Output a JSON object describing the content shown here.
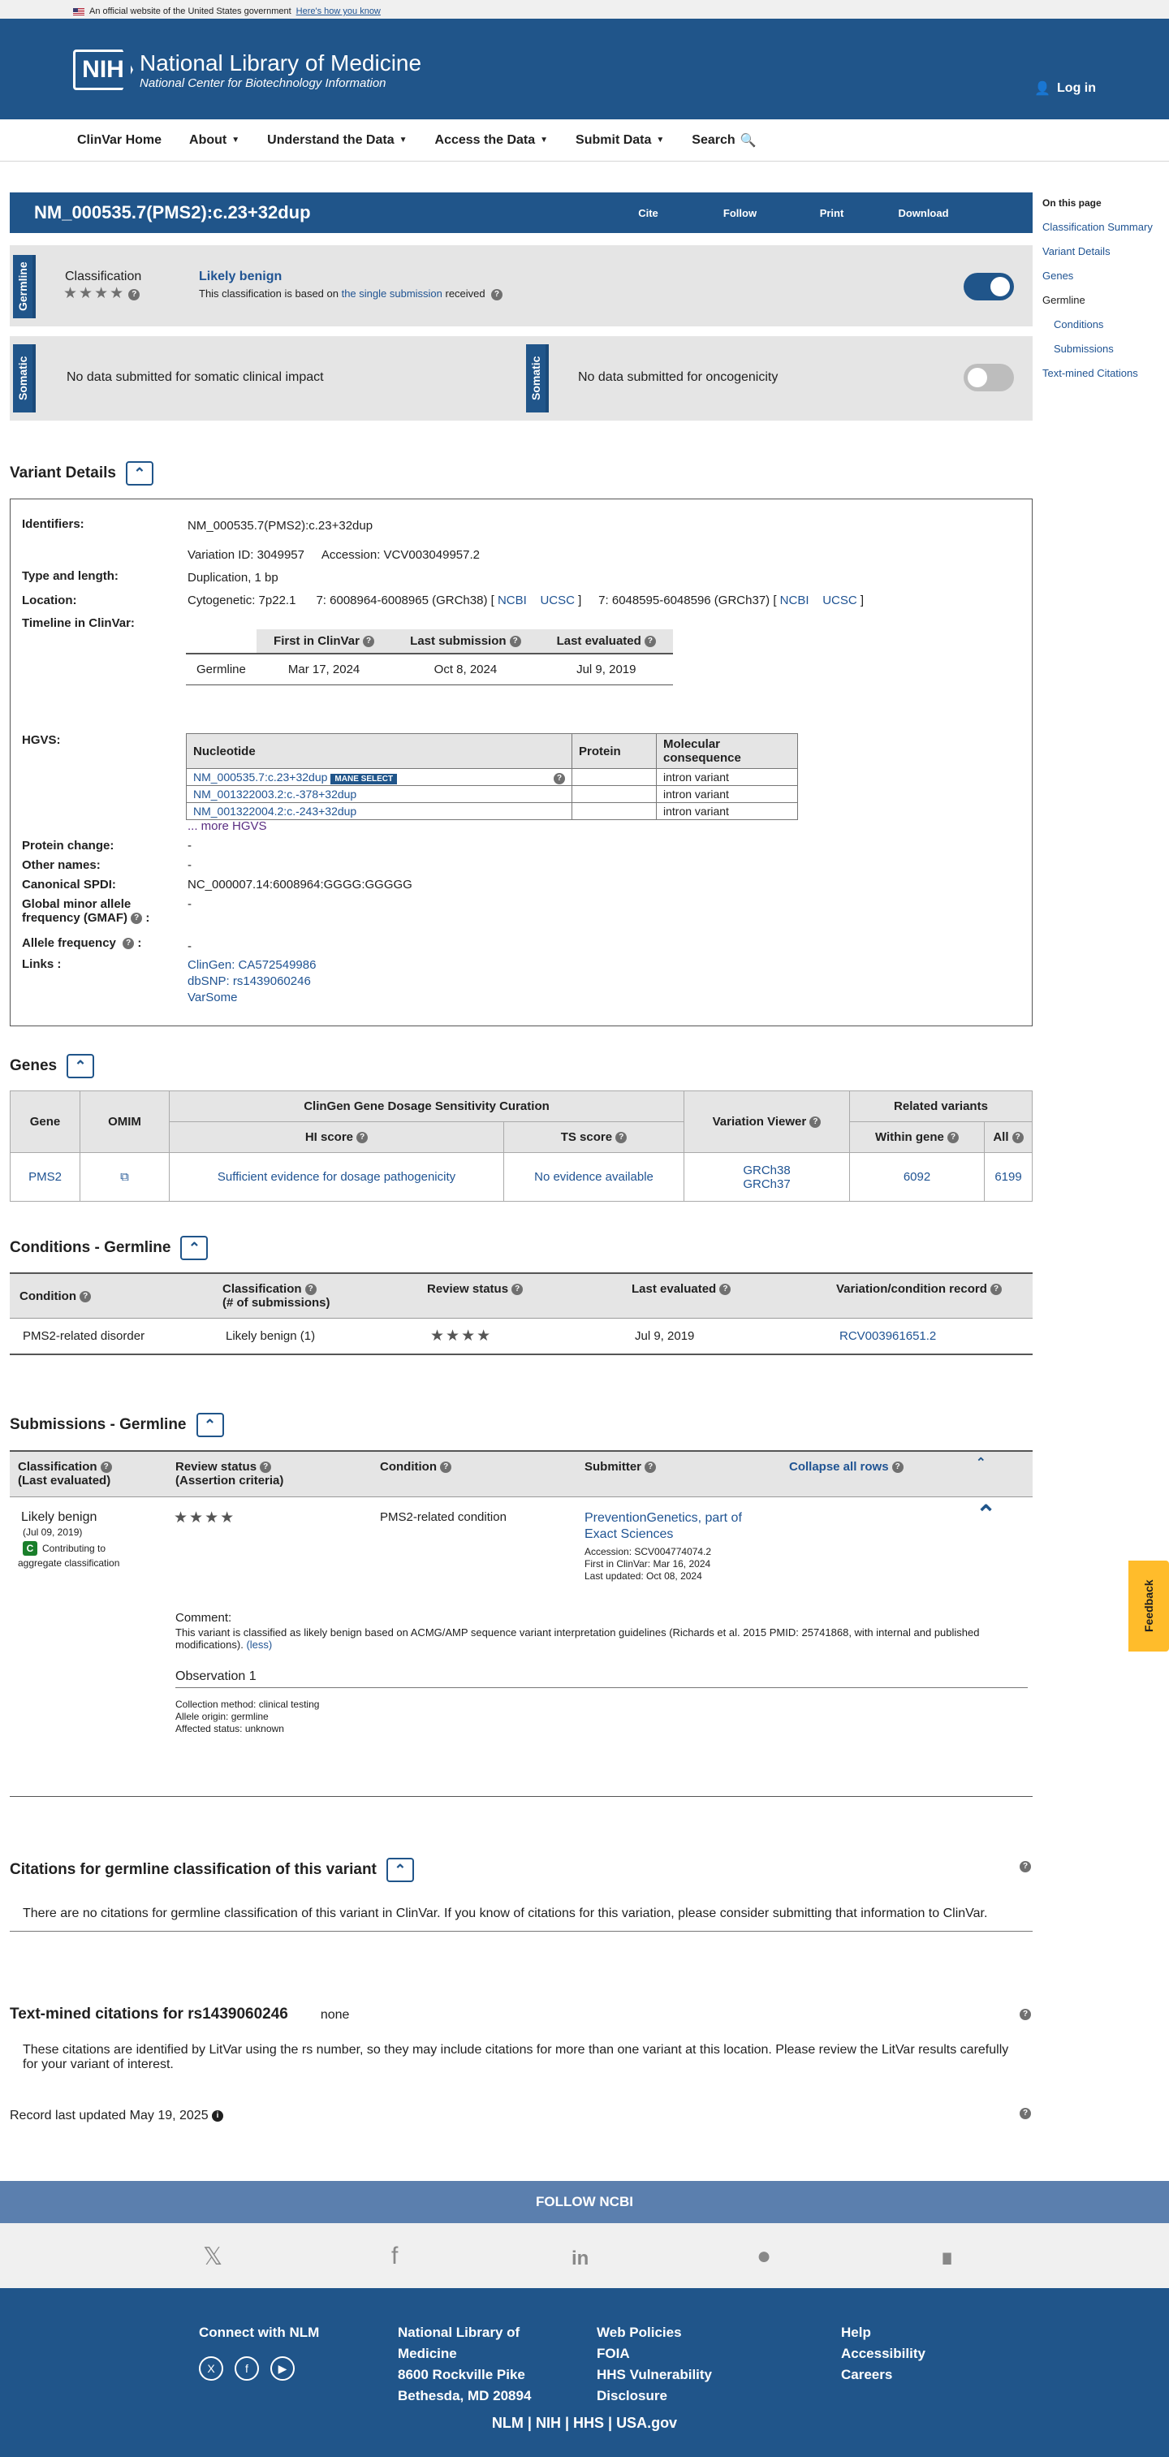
{
  "gov_banner": {
    "text": "An official website of the United States government",
    "link": "Here's how you know"
  },
  "header": {
    "logo": "NIH",
    "title": "National Library of Medicine",
    "subtitle": "National Center for Biotechnology Information",
    "login": "Log in"
  },
  "nav": [
    "ClinVar Home",
    "About",
    "Understand the Data",
    "Access the Data",
    "Submit Data",
    "Search"
  ],
  "title": {
    "name": "NM_000535.7(PMS2):c.23+32dup",
    "actions": [
      "Cite",
      "Follow",
      "Print",
      "Download"
    ]
  },
  "toc": {
    "heading": "On this page",
    "items": [
      "Classification Summary",
      "Variant Details",
      "Genes",
      "Germline",
      "Conditions",
      "Submissions",
      "Text-mined Citations"
    ]
  },
  "germline": {
    "tag": "Germline",
    "label": "Classification",
    "value": "Likely benign",
    "desc_pre": "This classification is based on ",
    "desc_link": "the single submission",
    "desc_post": " received"
  },
  "somatic": {
    "tag": "Somatic",
    "clinical": "No data submitted for somatic clinical impact",
    "oncogenicity": "No data submitted for oncogenicity"
  },
  "variant_details": {
    "heading": "Variant Details",
    "identifiers_label": "Identifiers:",
    "identifier": "NM_000535.7(PMS2):c.23+32dup",
    "variation_id": "Variation ID: 3049957",
    "accession": "Accession: VCV003049957.2",
    "type_label": "Type and length:",
    "type": "Duplication, 1 bp",
    "location_label": "Location:",
    "cytogenetic": "Cytogenetic: 7p22.1",
    "grch38": "7: 6008964-6008965 (GRCh38) [",
    "grch37": "7: 6048595-6048596 (GRCh37) [",
    "ncbi": "NCBI",
    "ucsc": "UCSC",
    "timeline_label": "Timeline in ClinVar:",
    "timeline_headers": [
      "First in ClinVar",
      "Last submission",
      "Last evaluated"
    ],
    "timeline_row": [
      "Germline",
      "Mar 17, 2024",
      "Oct 8, 2024",
      "Jul 9, 2019"
    ],
    "hgvs_label": "HGVS:",
    "hgvs_headers": [
      "Nucleotide",
      "Protein",
      "Molecular consequence"
    ],
    "hgvs_rows": [
      [
        "NM_000535.7:c.23+32dup",
        "",
        "intron variant"
      ],
      [
        "NM_001322003.2:c.-378+32dup",
        "",
        "intron variant"
      ],
      [
        "NM_001322004.2:c.-243+32dup",
        "",
        "intron variant"
      ]
    ],
    "mane": "MANE SELECT",
    "more": "... more HGVS",
    "protein_change_label": "Protein change:",
    "protein_change": "-",
    "other_names_label": "Other names:",
    "other_names": "-",
    "spdi_label": "Canonical SPDI:",
    "spdi": "NC_000007.14:6008964:GGGG:GGGGG",
    "gmaf_label1": "Global minor allele",
    "gmaf_label2": "frequency (GMAF)",
    "gmaf": "-",
    "af_label": "Allele frequency",
    "af": "-",
    "links_label": "Links :",
    "links": [
      "ClinGen: CA572549986",
      "dbSNP: rs1439060246",
      "VarSome"
    ]
  },
  "genes": {
    "heading": "Genes",
    "headers": [
      "Gene",
      "OMIM",
      "ClinGen Gene Dosage Sensitivity Curation",
      "HI score",
      "TS score",
      "Variation Viewer",
      "Related variants",
      "Within gene",
      "All"
    ],
    "row": {
      "gene": "PMS2",
      "hi": "Sufficient evidence for dosage pathogenicity",
      "ts": "No evidence available",
      "viewer1": "GRCh38",
      "viewer2": "GRCh37",
      "within": "6092",
      "all": "6199"
    }
  },
  "conditions": {
    "heading": "Conditions - Germline",
    "headers": [
      "Condition",
      "Classification",
      "(# of submissions)",
      "Review status",
      "Last evaluated",
      "Variation/condition record"
    ],
    "row": [
      "PMS2-related disorder",
      "Likely benign (1)",
      "Jul 9, 2019",
      "RCV003961651.2"
    ]
  },
  "submissions": {
    "heading": "Submissions - Germline",
    "h_class1": "Classification",
    "h_class2": "(Last evaluated)",
    "h_rev1": "Review status",
    "h_rev2": "(Assertion criteria)",
    "h_cond": "Condition",
    "h_sub": "Submitter",
    "collapse": "Collapse all rows",
    "class": "Likely benign",
    "date": "(Jul 09, 2019)",
    "badge": "C",
    "contrib1": "Contributing to",
    "contrib2": "aggregate classification",
    "condition": "PMS2-related condition",
    "submitter1": "PreventionGenetics, part of",
    "submitter2": "Exact Sciences",
    "accession": "Accession: SCV004774074.2",
    "first": "First in ClinVar: Mar 16, 2024",
    "updated": "Last updated: Oct 08, 2024",
    "comment_label": "Comment:",
    "comment": "This variant is classified as likely benign based on ACMG/AMP sequence variant interpretation guidelines (Richards et al. 2015 PMID: 25741868, with internal and published modifications).",
    "less": "(less)",
    "obs": "Observation 1",
    "method": "Collection method: clinical testing",
    "origin": "Allele origin: germline",
    "affected": "Affected status: unknown"
  },
  "citations": {
    "heading": "Citations for germline classification of this variant",
    "text": "There are no citations for germline classification of this variant in ClinVar. If you know of citations for this variation, please consider submitting that information to ClinVar."
  },
  "textmined": {
    "heading": "Text-mined citations for rs1439060246",
    "none": "none",
    "text": "These citations are identified by LitVar using the rs number, so they may include citations for more than one variant at this location. Please review the LitVar results carefully for your variant of interest."
  },
  "record": "Record last updated May 19, 2025",
  "footer": {
    "follow": "FOLLOW NCBI",
    "connect": "Connect with NLM",
    "addr": [
      "National Library of",
      "Medicine",
      "8600 Rockville Pike",
      "Bethesda, MD 20894"
    ],
    "policies": [
      "Web Policies",
      "FOIA",
      "HHS Vulnerability",
      "Disclosure"
    ],
    "help": [
      "Help",
      "Accessibility",
      "Careers"
    ],
    "bottom": [
      "NLM",
      "NIH",
      "HHS",
      "USA.gov"
    ]
  },
  "feedback": "Feedback"
}
